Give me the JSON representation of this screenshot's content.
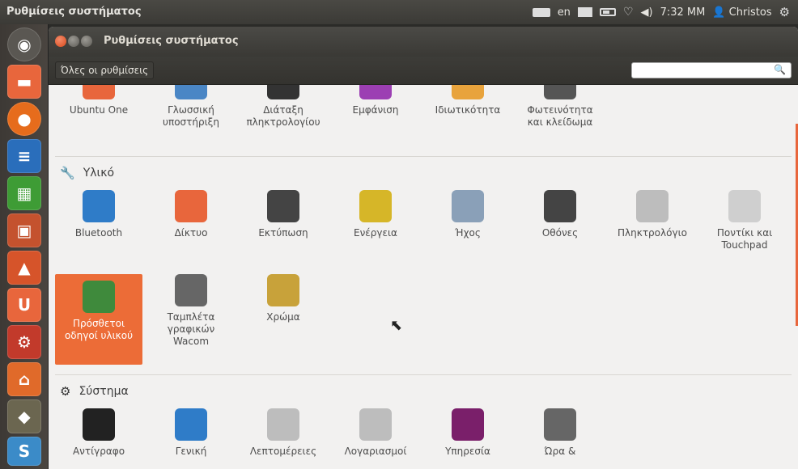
{
  "panel": {
    "app_title": "Ρυθμίσεις συστήματος",
    "lang": "en",
    "time": "7:32 MM",
    "user": "Christos"
  },
  "window": {
    "title": "Ρυθμίσεις συστήματος",
    "all_settings": "Όλες οι ρυθμίσεις",
    "search_placeholder": ""
  },
  "personal_row": [
    {
      "label": "Ubuntu One",
      "icon": "ubuntu-one-icon",
      "color": "#e8663c"
    },
    {
      "label": "Γλωσσική υποστήριξη",
      "icon": "language-support-icon",
      "color": "#4a86c5"
    },
    {
      "label": "Διάταξη πληκτρολογίου",
      "icon": "keyboard-layout-icon",
      "color": "#333333"
    },
    {
      "label": "Εμφάνιση",
      "icon": "appearance-icon",
      "color": "#9c3fb3"
    },
    {
      "label": "Ιδιωτικότητα",
      "icon": "privacy-icon",
      "color": "#e8a33c"
    },
    {
      "label": "Φωτεινότητα και κλείδωμα",
      "icon": "brightness-lock-icon",
      "color": "#555555"
    }
  ],
  "hardware": {
    "title": "Υλικό",
    "items": [
      {
        "label": "Bluetooth",
        "icon": "bluetooth-icon",
        "color": "#2f7cc8"
      },
      {
        "label": "Δίκτυο",
        "icon": "network-icon",
        "color": "#e8663c"
      },
      {
        "label": "Εκτύπωση",
        "icon": "printer-icon",
        "color": "#444444"
      },
      {
        "label": "Ενέργεια",
        "icon": "power-icon",
        "color": "#d6b628"
      },
      {
        "label": "Ήχος",
        "icon": "sound-icon",
        "color": "#8aa0b8"
      },
      {
        "label": "Οθόνες",
        "icon": "displays-icon",
        "color": "#444444"
      },
      {
        "label": "Πληκτρολόγιο",
        "icon": "keyboard-icon",
        "color": "#bdbdbd"
      },
      {
        "label": "Ποντίκι και Touchpad",
        "icon": "mouse-icon",
        "color": "#cfcfcf"
      },
      {
        "label": "Πρόσθετοι οδηγοί υλικού",
        "icon": "additional-drivers-icon",
        "color": "#3f8a3c"
      },
      {
        "label": "Ταμπλέτα γραφικών Wacom",
        "icon": "wacom-tablet-icon",
        "color": "#666666"
      },
      {
        "label": "Χρώμα",
        "icon": "color-icon",
        "color": "#c8a23a"
      }
    ]
  },
  "system": {
    "title": "Σύστημα",
    "items": [
      {
        "label": "Αντίγραφο",
        "icon": "backup-icon",
        "color": "#222222"
      },
      {
        "label": "Γενική",
        "icon": "universal-access-icon",
        "color": "#2f7cc8"
      },
      {
        "label": "Λεπτομέρειες",
        "icon": "details-icon",
        "color": "#bdbdbd"
      },
      {
        "label": "Λογαριασμοί",
        "icon": "user-accounts-icon",
        "color": "#bdbdbd"
      },
      {
        "label": "Υπηρεσία",
        "icon": "landscape-service-icon",
        "color": "#7a1f6a"
      },
      {
        "label": "Ώρα &",
        "icon": "time-date-icon",
        "color": "#666666"
      }
    ]
  },
  "colors": {
    "accent": "#e8663c",
    "selected": "#ec6c37"
  }
}
